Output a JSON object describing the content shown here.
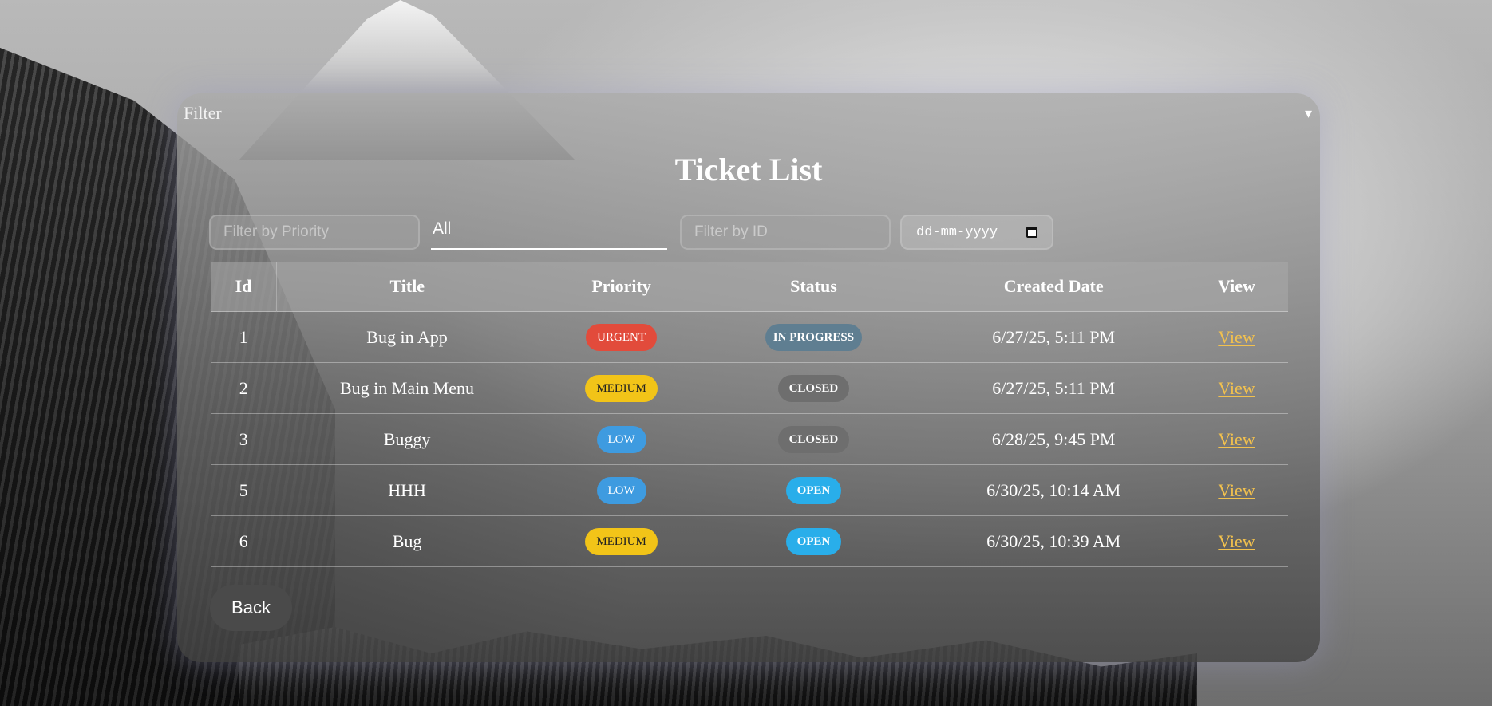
{
  "filter_bar": {
    "label": "Filter",
    "toggle_icon": "▾"
  },
  "title": "Ticket List",
  "filters": {
    "priority_placeholder": "Filter by Priority",
    "status_value": "All",
    "id_placeholder": "Filter by ID",
    "date_placeholder": "dd-mm-yyyy"
  },
  "table": {
    "headers": [
      "Id",
      "Title",
      "Priority",
      "Status",
      "Created Date",
      "View"
    ],
    "rows": [
      {
        "id": "1",
        "title": "Bug in App",
        "priority": "URGENT",
        "status": "IN PROGRESS",
        "created": "6/27/25, 5:11 PM",
        "view": "View"
      },
      {
        "id": "2",
        "title": "Bug in Main Menu",
        "priority": "MEDIUM",
        "status": "CLOSED",
        "created": "6/27/25, 5:11 PM",
        "view": "View"
      },
      {
        "id": "3",
        "title": "Buggy",
        "priority": "LOW",
        "status": "CLOSED",
        "created": "6/28/25, 9:45 PM",
        "view": "View"
      },
      {
        "id": "5",
        "title": "HHH",
        "priority": "LOW",
        "status": "OPEN",
        "created": "6/30/25, 10:14 AM",
        "view": "View"
      },
      {
        "id": "6",
        "title": "Bug",
        "priority": "MEDIUM",
        "status": "OPEN",
        "created": "6/30/25, 10:39 AM",
        "view": "View"
      }
    ]
  },
  "back_label": "Back",
  "colors": {
    "urgent": "#e24b3b",
    "medium": "#f2c418",
    "low": "#3e9be0",
    "in_progress": "#5f7e91",
    "closed": "#6e6e6e",
    "open": "#29aeea",
    "link": "#f2c14e"
  }
}
